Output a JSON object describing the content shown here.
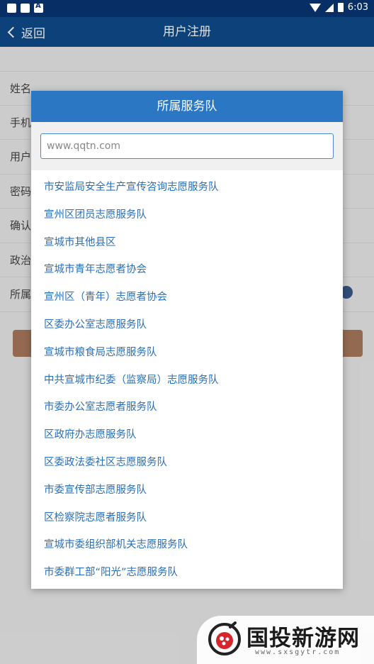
{
  "status_bar": {
    "time": "6:03"
  },
  "header": {
    "back_label": "返回",
    "title": "用户注册"
  },
  "form": {
    "rows": [
      "姓名",
      "手机",
      "用户",
      "密码",
      "确认",
      "政治",
      "所属"
    ]
  },
  "dialog": {
    "title": "所属服务队",
    "search": {
      "placeholder": "www.qqtn.com"
    },
    "items": [
      "市安监局安全生产宣传咨询志愿服务队",
      "宣州区团员志愿服务队",
      "宣城市其他县区",
      "宣城市青年志愿者协会",
      "宣州区（青年）志愿者协会",
      "区委办公室志愿服务队",
      "宣城市粮食局志愿服务队",
      "中共宣城市纪委（监察局）志愿服务队",
      "市委办公室志愿者服务队",
      "区政府办志愿服务队",
      "区委政法委社区志愿服务队",
      "市委宣传部志愿服务队",
      "区检察院志愿者服务队",
      "宣城市委组织部机关志愿服务队",
      "市委群工部“阳光”志愿服务队"
    ]
  },
  "watermark": {
    "text": "国投新游网",
    "url": "www.sxsgytr.com"
  },
  "colors": {
    "status_bar": "#072f66",
    "header": "#0e4a8b",
    "dialog_title": "#2c77c4",
    "list_text": "#2a6fb8"
  }
}
